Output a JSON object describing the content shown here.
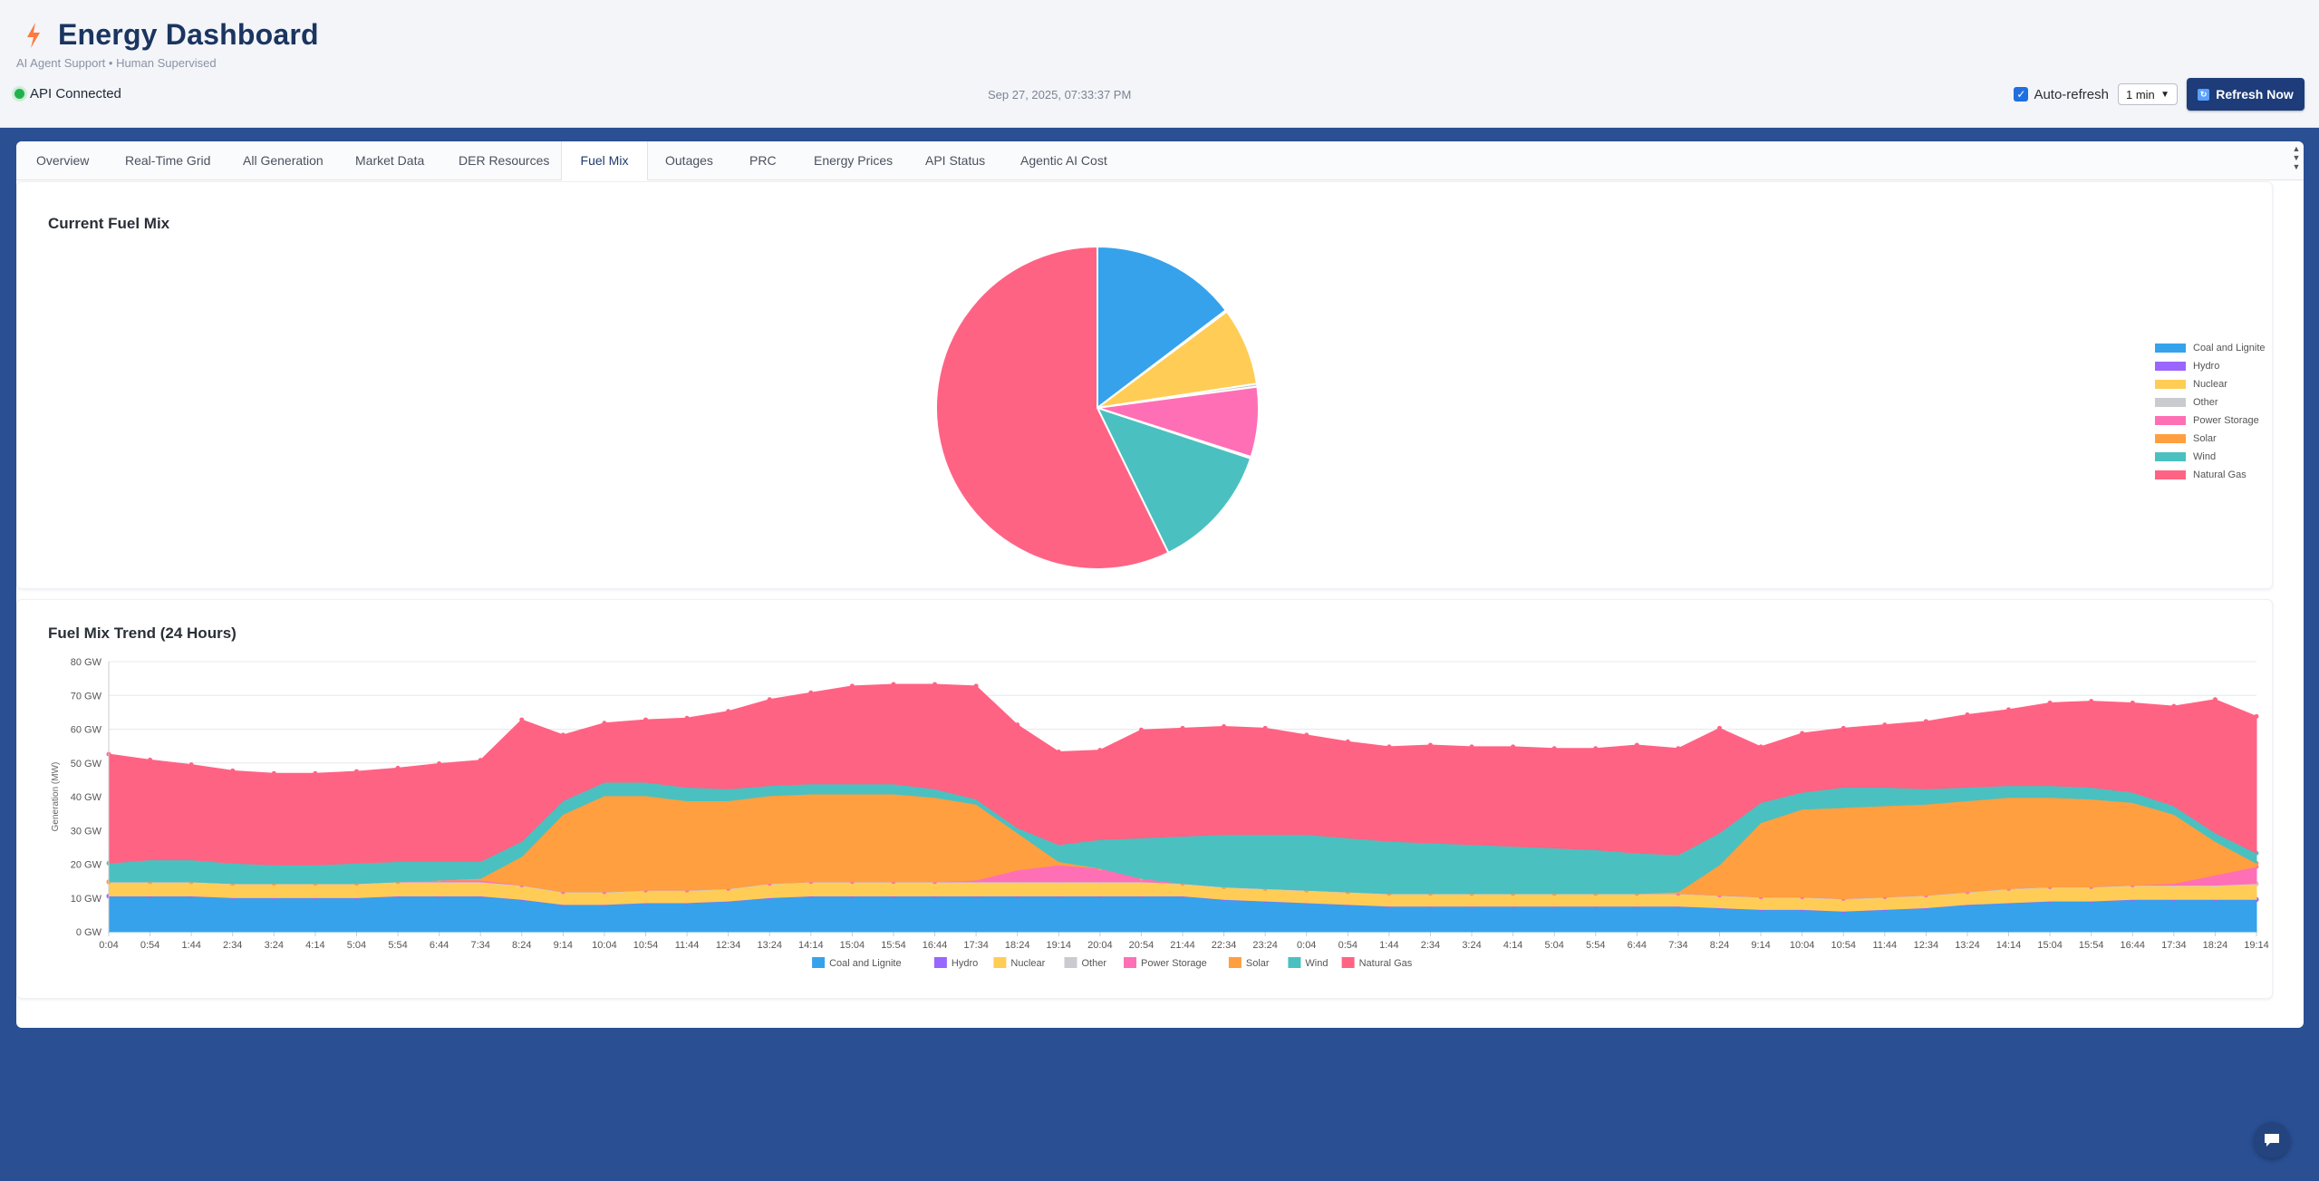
{
  "header": {
    "title": "Energy Dashboard",
    "subtitle": "AI Agent Support • Human Supervised",
    "api_status": "API Connected",
    "timestamp": "Sep 27, 2025, 07:33:37 PM",
    "auto_refresh_label": "Auto-refresh",
    "auto_refresh_checked": true,
    "interval_selected": "1 min",
    "refresh_button": "Refresh Now",
    "icon": "lightning-bolt-icon"
  },
  "tabs": [
    {
      "label": "Overview"
    },
    {
      "label": "Real-Time Grid"
    },
    {
      "label": "All Generation"
    },
    {
      "label": "Market Data"
    },
    {
      "label": "DER Resources"
    },
    {
      "label": "Fuel Mix",
      "active": true
    },
    {
      "label": "Outages"
    },
    {
      "label": "PRC"
    },
    {
      "label": "Energy Prices"
    },
    {
      "label": "API Status"
    },
    {
      "label": "Agentic AI Cost"
    }
  ],
  "colors": {
    "Coal and Lignite": "#36a2eb",
    "Hydro": "#9966ff",
    "Nuclear": "#ffcd56",
    "Other": "#c9cbcf",
    "Power Storage": "#ff6fb5",
    "Solar": "#ff9f40",
    "Wind": "#4bc0c0",
    "Natural Gas": "#ff6384"
  },
  "chart_data": [
    {
      "type": "pie",
      "title": "Current Fuel Mix",
      "legend_position": "right",
      "categories": [
        "Coal and Lignite",
        "Hydro",
        "Nuclear",
        "Other",
        "Power Storage",
        "Solar",
        "Wind",
        "Natural Gas"
      ],
      "values": [
        9.6,
        0.1,
        5.1,
        0.2,
        4.6,
        0.1,
        8.3,
        37.5
      ]
    },
    {
      "type": "area",
      "stacked": true,
      "title": "Fuel Mix Trend (24 Hours)",
      "xlabel": "",
      "ylabel": "Generation (MW)",
      "ylim": [
        0,
        80
      ],
      "yticks": [
        "0 GW",
        "10 GW",
        "20 GW",
        "30 GW",
        "40 GW",
        "50 GW",
        "60 GW",
        "70 GW",
        "80 GW"
      ],
      "legend_position": "bottom",
      "grid": true,
      "x": [
        "0:04",
        "0:54",
        "1:44",
        "2:34",
        "3:24",
        "4:14",
        "5:04",
        "5:54",
        "6:44",
        "7:34",
        "8:24",
        "9:14",
        "10:04",
        "10:54",
        "11:44",
        "12:34",
        "13:24",
        "14:14",
        "15:04",
        "15:54",
        "16:44",
        "17:34",
        "18:24",
        "19:14",
        "20:04",
        "20:54",
        "21:44",
        "22:34",
        "23:24",
        "0:04",
        "0:54",
        "1:44",
        "2:34",
        "3:24",
        "4:14",
        "5:04",
        "5:54",
        "6:44",
        "7:34",
        "8:24",
        "9:14",
        "10:04",
        "10:54",
        "11:44",
        "12:34",
        "13:24",
        "14:14",
        "15:04",
        "15:54",
        "16:44",
        "17:34",
        "18:24",
        "19:14"
      ],
      "series": [
        {
          "name": "Coal and Lignite",
          "values": [
            10.5,
            10.5,
            10.5,
            10.0,
            10.0,
            10.0,
            10.0,
            10.5,
            10.5,
            10.5,
            9.5,
            8.0,
            8.0,
            8.5,
            8.5,
            9.0,
            10.0,
            10.5,
            10.5,
            10.5,
            10.5,
            10.5,
            10.5,
            10.5,
            10.5,
            10.5,
            10.5,
            9.5,
            9.0,
            8.5,
            8.0,
            7.5,
            7.5,
            7.5,
            7.5,
            7.5,
            7.5,
            7.5,
            7.5,
            7.0,
            6.5,
            6.5,
            6.0,
            6.5,
            7.0,
            8.0,
            8.5,
            9.0,
            9.0,
            9.5,
            9.5,
            9.5,
            9.5
          ]
        },
        {
          "name": "Hydro",
          "values": [
            0.1,
            0.1,
            0.1,
            0.1,
            0.1,
            0.1,
            0.1,
            0.1,
            0.1,
            0.1,
            0.1,
            0.1,
            0.1,
            0.1,
            0.1,
            0.1,
            0.1,
            0.1,
            0.1,
            0.1,
            0.1,
            0.1,
            0.1,
            0.1,
            0.1,
            0.1,
            0.1,
            0.1,
            0.1,
            0.1,
            0.1,
            0.1,
            0.1,
            0.1,
            0.1,
            0.1,
            0.1,
            0.1,
            0.1,
            0.1,
            0.1,
            0.1,
            0.1,
            0.1,
            0.1,
            0.1,
            0.1,
            0.1,
            0.1,
            0.1,
            0.1,
            0.1,
            0.1
          ]
        },
        {
          "name": "Nuclear",
          "values": [
            4.0,
            4.0,
            4.0,
            4.0,
            4.0,
            4.0,
            4.0,
            4.0,
            4.0,
            4.0,
            4.0,
            3.5,
            3.5,
            3.5,
            3.5,
            3.5,
            4.0,
            4.0,
            4.0,
            4.0,
            4.0,
            4.0,
            4.0,
            4.0,
            4.0,
            4.0,
            3.5,
            3.5,
            3.5,
            3.5,
            3.5,
            3.5,
            3.5,
            3.5,
            3.5,
            3.5,
            3.5,
            3.5,
            3.5,
            3.5,
            3.5,
            3.5,
            3.5,
            3.5,
            3.5,
            3.5,
            4.0,
            4.0,
            4.0,
            4.0,
            4.0,
            4.0,
            4.5
          ]
        },
        {
          "name": "Other",
          "values": [
            0.2,
            0.2,
            0.2,
            0.2,
            0.2,
            0.2,
            0.2,
            0.2,
            0.2,
            0.2,
            0.2,
            0.2,
            0.2,
            0.2,
            0.2,
            0.2,
            0.2,
            0.2,
            0.2,
            0.2,
            0.2,
            0.2,
            0.2,
            0.2,
            0.2,
            0.2,
            0.2,
            0.2,
            0.2,
            0.2,
            0.2,
            0.2,
            0.2,
            0.2,
            0.2,
            0.2,
            0.2,
            0.2,
            0.2,
            0.2,
            0.2,
            0.2,
            0.2,
            0.2,
            0.2,
            0.2,
            0.2,
            0.2,
            0.2,
            0.2,
            0.2,
            0.2,
            0.2
          ]
        },
        {
          "name": "Power Storage",
          "values": [
            0.0,
            0.0,
            0.0,
            0.0,
            0.0,
            0.0,
            0.0,
            0.0,
            0.5,
            0.5,
            0.0,
            0.0,
            0.0,
            0.0,
            0.0,
            0.0,
            0.0,
            0.0,
            0.0,
            0.0,
            0.0,
            0.5,
            3.5,
            5.0,
            4.0,
            1.0,
            0.0,
            0.0,
            0.0,
            0.0,
            0.0,
            0.0,
            0.0,
            0.0,
            0.0,
            0.0,
            0.0,
            0.0,
            0.0,
            0.0,
            0.0,
            0.0,
            0.0,
            0.0,
            0.0,
            0.0,
            0.0,
            0.0,
            0.0,
            0.0,
            0.5,
            3.0,
            5.0
          ]
        },
        {
          "name": "Solar",
          "values": [
            0.0,
            0.0,
            0.0,
            0.0,
            0.0,
            0.0,
            0.0,
            0.0,
            0.0,
            0.5,
            8.5,
            23.0,
            28.5,
            28.0,
            26.5,
            26.0,
            26.0,
            26.0,
            26.0,
            26.0,
            25.0,
            22.5,
            11.0,
            1.0,
            0.0,
            0.0,
            0.0,
            0.0,
            0.0,
            0.0,
            0.0,
            0.0,
            0.0,
            0.0,
            0.0,
            0.0,
            0.0,
            0.0,
            0.5,
            9.0,
            22.0,
            26.0,
            27.0,
            27.0,
            27.0,
            27.0,
            27.0,
            26.5,
            26.0,
            24.5,
            20.5,
            10.0,
            1.0
          ]
        },
        {
          "name": "Wind",
          "values": [
            5.5,
            6.5,
            6.5,
            6.0,
            5.5,
            5.5,
            6.0,
            6.0,
            5.5,
            5.0,
            4.5,
            4.0,
            4.0,
            4.0,
            4.0,
            3.5,
            3.0,
            3.0,
            3.0,
            3.0,
            2.5,
            1.5,
            1.5,
            5.0,
            8.5,
            12.0,
            14.0,
            15.5,
            16.0,
            16.5,
            16.0,
            15.5,
            15.0,
            14.5,
            14.0,
            13.5,
            13.0,
            12.0,
            11.0,
            9.5,
            6.0,
            5.0,
            6.0,
            5.5,
            4.5,
            4.0,
            3.5,
            3.5,
            3.5,
            3.0,
            2.5,
            2.5,
            3.0
          ]
        },
        {
          "name": "Natural Gas",
          "values": [
            32.3,
            29.6,
            28.2,
            27.4,
            27.1,
            27.1,
            27.2,
            27.7,
            29.0,
            30.0,
            36.0,
            19.5,
            17.5,
            18.5,
            20.5,
            23.0,
            25.5,
            27.0,
            29.0,
            29.5,
            31.0,
            33.5,
            30.5,
            27.5,
            26.5,
            32.0,
            32.0,
            32.0,
            31.5,
            29.5,
            28.5,
            28.0,
            29.0,
            29.0,
            29.5,
            29.5,
            30.0,
            32.0,
            31.5,
            31.0,
            16.5,
            17.5,
            17.5,
            18.5,
            20.0,
            21.5,
            22.5,
            24.5,
            25.5,
            26.5,
            29.5,
            39.5,
            40.5
          ]
        }
      ]
    }
  ],
  "chat": {
    "icon": "chat-bubble-icon"
  }
}
